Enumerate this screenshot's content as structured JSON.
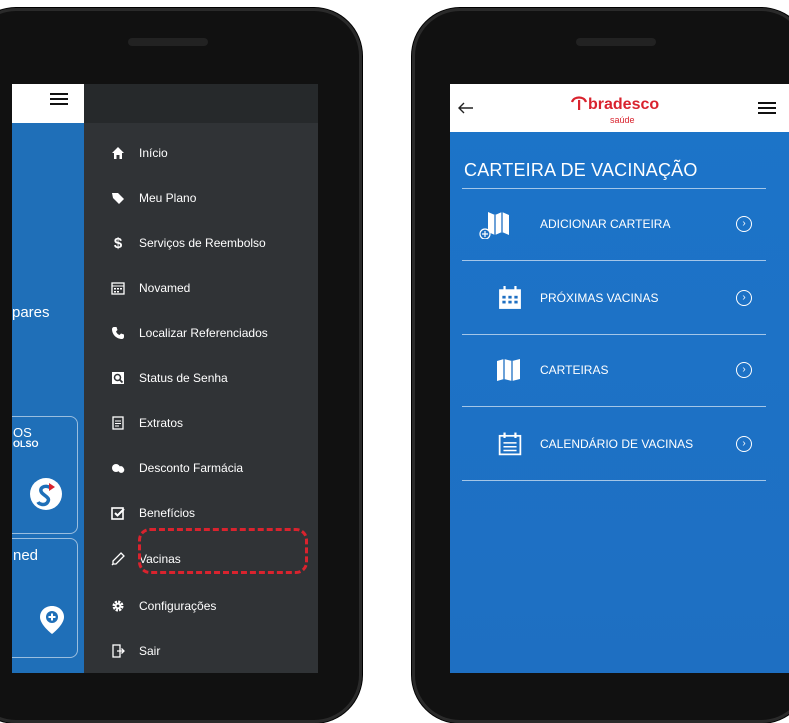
{
  "left": {
    "background_text": [
      "pares",
      "OS",
      "OLSO",
      "ned"
    ],
    "menu": [
      {
        "label": "Início",
        "icon": "home-icon"
      },
      {
        "label": "Meu Plano",
        "icon": "tag-icon"
      },
      {
        "label": "Serviços de Reembolso",
        "icon": "dollar-icon"
      },
      {
        "label": "Novamed",
        "icon": "calendar-icon"
      },
      {
        "label": "Localizar Referenciados",
        "icon": "phone-icon"
      },
      {
        "label": "Status de Senha",
        "icon": "search-doc-icon"
      },
      {
        "label": "Extratos",
        "icon": "document-icon"
      },
      {
        "label": "Desconto Farmácia",
        "icon": "pills-icon"
      },
      {
        "label": "Benefícios",
        "icon": "checkbox-icon"
      },
      {
        "label": "Vacinas",
        "icon": "syringe-icon"
      },
      {
        "label": "Configurações",
        "icon": "gear-icon"
      },
      {
        "label": "Sair",
        "icon": "exit-icon"
      }
    ],
    "highlighted_item": "Vacinas"
  },
  "right": {
    "brand": "bradesco",
    "brand_sub": "saúde",
    "section_title": "CARTEIRA DE VACINAÇÃO",
    "rows": [
      {
        "label": "ADICIONAR CARTEIRA",
        "icon": "add-card-icon"
      },
      {
        "label": "PRÓXIMAS VACINAS",
        "icon": "calendar-grid-icon"
      },
      {
        "label": "CARTEIRAS",
        "icon": "map-icon"
      },
      {
        "label": "CALENDÁRIO DE VACINAS",
        "icon": "calendar-list-icon"
      }
    ]
  },
  "colors": {
    "drawer": "#303336",
    "brand_red": "#d9232e",
    "blue": "#1e6fc2"
  }
}
